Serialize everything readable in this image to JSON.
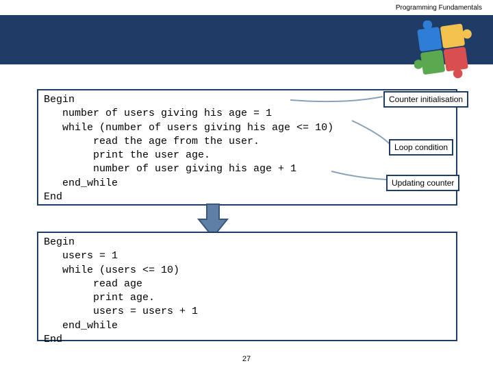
{
  "header": {
    "title": "Programming Fundamentals"
  },
  "code1": {
    "text": "Begin\n   number of users giving his age = 1\n   while (number of users giving his age <= 10)\n        read the age from the user.\n        print the user age.\n        number of user giving his age + 1\n   end_while\nEnd"
  },
  "code2": {
    "text": "Begin\n   users = 1\n   while (users <= 10)\n        read age\n        print age.\n        users = users + 1\n   end_while\nEnd"
  },
  "callouts": {
    "init": "Counter initialisation",
    "cond": "Loop condition",
    "upd": "Updating counter"
  },
  "footer": {
    "page": "27"
  }
}
